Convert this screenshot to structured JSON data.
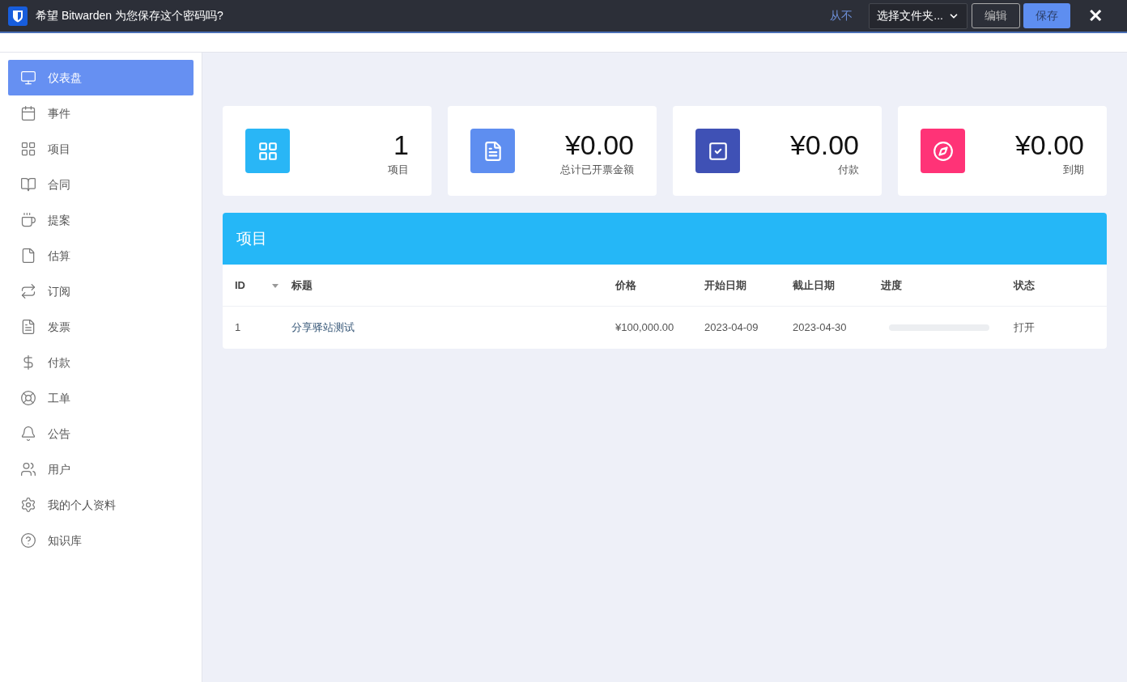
{
  "save_bar": {
    "message": "希望 Bitwarden 为您保存这个密码吗?",
    "never": "从不",
    "folder": "选择文件夹...",
    "edit": "编辑",
    "save": "保存",
    "close": "✕"
  },
  "sidebar": {
    "items": [
      {
        "label": "仪表盘",
        "selected": true
      },
      {
        "label": "事件",
        "selected": false
      },
      {
        "label": "项目",
        "selected": false
      },
      {
        "label": "合同",
        "selected": false
      },
      {
        "label": "提案",
        "selected": false
      },
      {
        "label": "估算",
        "selected": false
      },
      {
        "label": "订阅",
        "selected": false
      },
      {
        "label": "发票",
        "selected": false
      },
      {
        "label": "付款",
        "selected": false
      },
      {
        "label": "工单",
        "selected": false
      },
      {
        "label": "公告",
        "selected": false
      },
      {
        "label": "用户",
        "selected": false
      },
      {
        "label": "我的个人资料",
        "selected": false
      },
      {
        "label": "知识库",
        "selected": false
      }
    ]
  },
  "stats": [
    {
      "value": "1",
      "label": "项目",
      "color": "#29b6f6"
    },
    {
      "value": "¥0.00",
      "label": "总计已开票金额",
      "color": "#5e8ef0"
    },
    {
      "value": "¥0.00",
      "label": "付款",
      "color": "#3f51b5"
    },
    {
      "value": "¥0.00",
      "label": "到期",
      "color": "#ff3377"
    }
  ],
  "projects": {
    "title": "项目",
    "columns": [
      "ID",
      "标题",
      "价格",
      "开始日期",
      "截止日期",
      "进度",
      "状态"
    ],
    "rows": [
      {
        "id": "1",
        "title": "分享驿站测试",
        "price": "¥100,000.00",
        "start": "2023-04-09",
        "end": "2023-04-30",
        "progress": {
          "level": 0
        },
        "status": "打开"
      }
    ]
  }
}
